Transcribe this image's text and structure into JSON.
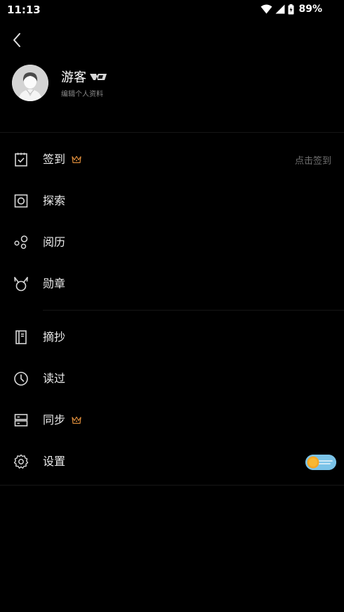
{
  "status_bar": {
    "time": "11:13",
    "battery": "89%"
  },
  "profile": {
    "name": "游客",
    "edit_hint": "编辑个人资料"
  },
  "menu": {
    "checkin": {
      "label": "签到",
      "hint": "点击签到"
    },
    "explore": {
      "label": "探索"
    },
    "history": {
      "label": "阅历"
    },
    "medals": {
      "label": "勋章"
    },
    "excerpts": {
      "label": "摘抄"
    },
    "read": {
      "label": "读过"
    },
    "sync": {
      "label": "同步"
    },
    "settings": {
      "label": "设置"
    }
  },
  "colors": {
    "crown": "#d98a3a",
    "toggle_bg": "#7ac3e8",
    "toggle_knob": "#f5a623"
  }
}
